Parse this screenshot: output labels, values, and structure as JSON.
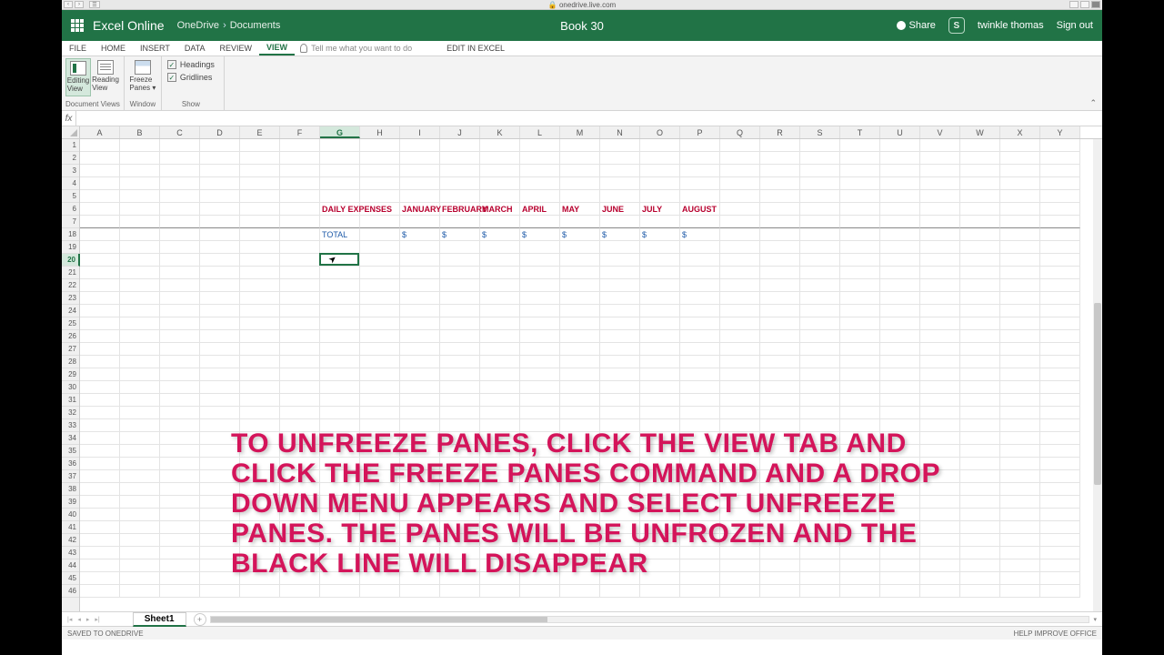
{
  "browser": {
    "url": "onedrive.live.com"
  },
  "header": {
    "app_name": "Excel Online",
    "breadcrumb_root": "OneDrive",
    "breadcrumb_folder": "Documents",
    "doc_title": "Book 30",
    "share": "Share",
    "user": "twinkle thomas",
    "signout": "Sign out"
  },
  "tabs": {
    "file": "FILE",
    "home": "HOME",
    "insert": "INSERT",
    "data": "DATA",
    "review": "REVIEW",
    "view": "VIEW",
    "tell_me": "Tell me what you want to do",
    "edit_in_excel": "EDIT IN EXCEL"
  },
  "ribbon": {
    "editing_view": "Editing\nView",
    "reading_view": "Reading\nView",
    "freeze_panes": "Freeze\nPanes",
    "headings": "Headings",
    "gridlines": "Gridlines",
    "group_docviews": "Document Views",
    "group_window": "Window",
    "group_show": "Show"
  },
  "columns": [
    "A",
    "B",
    "C",
    "D",
    "E",
    "F",
    "G",
    "H",
    "I",
    "J",
    "K",
    "L",
    "M",
    "N",
    "O",
    "P",
    "Q",
    "R",
    "S",
    "T",
    "U",
    "V",
    "W",
    "X",
    "Y"
  ],
  "rows_visible": [
    "1",
    "2",
    "3",
    "4",
    "5",
    "6",
    "7",
    "18",
    "19",
    "20",
    "21",
    "22",
    "23",
    "24",
    "25",
    "26",
    "27",
    "28",
    "29",
    "30",
    "31",
    "32",
    "33",
    "34",
    "35",
    "36",
    "37",
    "38",
    "39",
    "40",
    "41",
    "42",
    "43",
    "44",
    "45",
    "46"
  ],
  "selected_col": "G",
  "selected_row": "20",
  "sheet_data": {
    "r6": {
      "G": "DAILY EXPENSES",
      "I": "JANUARY",
      "J": "FEBRUARY",
      "K": "MARCH",
      "L": "APRIL",
      "M": "MAY",
      "N": "JUNE",
      "O": "JULY",
      "P": "AUGUST"
    },
    "r18": {
      "G": "TOTAL",
      "I": "$",
      "J": "$",
      "K": "$",
      "L": "$",
      "M": "$",
      "N": "$",
      "O": "$",
      "P": "$"
    }
  },
  "overlay": "TO UNFREEZE PANES, CLICK THE VIEW TAB AND CLICK THE FREEZE PANES COMMAND AND A DROP DOWN MENU APPEARS AND SELECT UNFREEZE PANES. THE PANES WILL BE UNFROZEN AND THE BLACK LINE WILL DISAPPEAR",
  "sheet_tab": "Sheet1",
  "status_left": "SAVED TO ONEDRIVE",
  "status_right": "HELP IMPROVE OFFICE"
}
